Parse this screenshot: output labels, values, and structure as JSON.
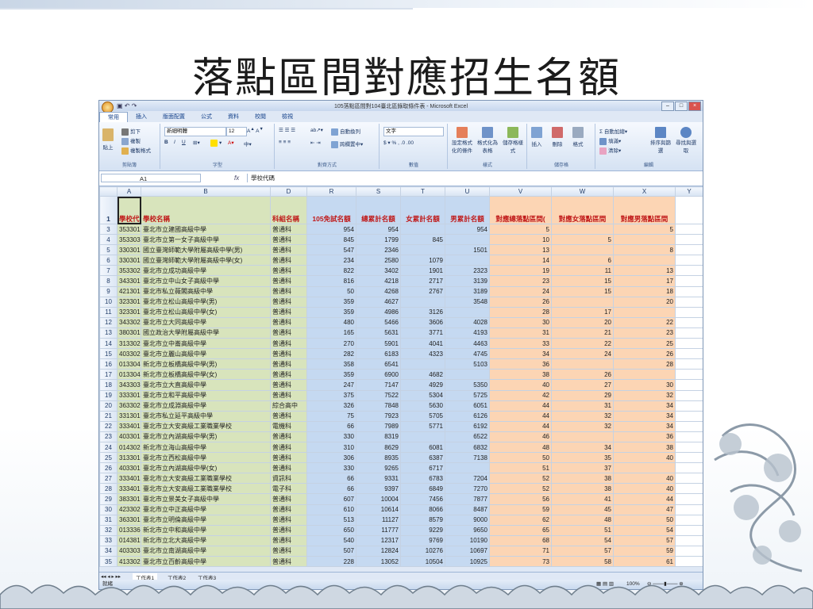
{
  "slide": {
    "title": "落點區間對應招生名額"
  },
  "excel": {
    "window_title": "105落點區間對104臺北區錄取條件表 - Microsoft Excel",
    "tabs": [
      "常用",
      "插入",
      "版面配置",
      "公式",
      "資料",
      "校閱",
      "檢視"
    ],
    "ribbon": {
      "clipboard": {
        "label": "剪貼簿",
        "paste": "貼上",
        "cut": "剪下",
        "copy": "複製",
        "format_painter": "複製格式"
      },
      "font": {
        "label": "字型",
        "name": "新細明體",
        "size": "12"
      },
      "alignment": {
        "label": "對齊方式",
        "wrap": "自動換列",
        "merge": "跨欄置中"
      },
      "number": {
        "label": "數值",
        "format": "文字"
      },
      "styles": {
        "label": "樣式",
        "conditional": "設定格式化的條件",
        "table": "格式化為表格",
        "cell": "儲存格樣式"
      },
      "cells": {
        "label": "儲存格",
        "insert": "插入",
        "delete": "刪除",
        "format": "格式"
      },
      "editing": {
        "label": "編輯",
        "autosum": "自動加總",
        "fill": "填滿",
        "clear": "清除",
        "sort": "排序與篩選",
        "find": "尋找與選取"
      }
    },
    "name_box": "A1",
    "formula": "學校代碼",
    "columns": [
      "A",
      "B",
      "D",
      "R",
      "S",
      "T",
      "U",
      "V",
      "W",
      "X",
      "Y"
    ],
    "header_row": {
      "num": "1",
      "A": "學校代",
      "B": "學校名稱",
      "D": "科組名稱",
      "R": "105免試名額",
      "S": "總累計名額",
      "T": "女累計名額",
      "U": "男累計名額",
      "V": "對應總落點區間(",
      "W": "對應女落點區間",
      "X": "對應男落點區間"
    },
    "rows": [
      [
        "3",
        "353301",
        "臺北市立建國高級中學",
        "普通科",
        "954",
        "954",
        "",
        "954",
        "5",
        "",
        "5"
      ],
      [
        "4",
        "353303",
        "臺北市立第一女子高級中學",
        "普通科",
        "845",
        "1799",
        "845",
        "",
        "10",
        "5",
        ""
      ],
      [
        "5",
        "330301",
        "國立臺灣師範大學附屬高級中學(男)",
        "普通科",
        "547",
        "2346",
        "",
        "1501",
        "13",
        "",
        "8"
      ],
      [
        "6",
        "330301",
        "國立臺灣師範大學附屬高級中學(女)",
        "普通科",
        "234",
        "2580",
        "1079",
        "",
        "14",
        "6",
        ""
      ],
      [
        "7",
        "353302",
        "臺北市立成功高級中學",
        "普通科",
        "822",
        "3402",
        "1901",
        "2323",
        "19",
        "11",
        "13"
      ],
      [
        "8",
        "343301",
        "臺北市立中山女子高級中學",
        "普通科",
        "816",
        "4218",
        "2717",
        "3139",
        "23",
        "15",
        "17"
      ],
      [
        "9",
        "421301",
        "臺北市私立薇閣高級中學",
        "普通科",
        "50",
        "4268",
        "2767",
        "3189",
        "24",
        "15",
        "18"
      ],
      [
        "10",
        "323301",
        "臺北市立松山高級中學(男)",
        "普通科",
        "359",
        "4627",
        "",
        "3548",
        "26",
        "",
        "20"
      ],
      [
        "11",
        "323301",
        "臺北市立松山高級中學(女)",
        "普通科",
        "359",
        "4986",
        "3126",
        "",
        "28",
        "17",
        ""
      ],
      [
        "12",
        "343302",
        "臺北市立大同高級中學",
        "普通科",
        "480",
        "5466",
        "3606",
        "4028",
        "30",
        "20",
        "22"
      ],
      [
        "13",
        "380301",
        "國立政治大學附屬高級中學",
        "普通科",
        "165",
        "5631",
        "3771",
        "4193",
        "31",
        "21",
        "23"
      ],
      [
        "14",
        "313302",
        "臺北市立中崙高級中學",
        "普通科",
        "270",
        "5901",
        "4041",
        "4463",
        "33",
        "22",
        "25"
      ],
      [
        "15",
        "403302",
        "臺北市立麗山高級中學",
        "普通科",
        "282",
        "6183",
        "4323",
        "4745",
        "34",
        "24",
        "26"
      ],
      [
        "16",
        "013304",
        "新北市立板橋高級中學(男)",
        "普通科",
        "358",
        "6541",
        "",
        "5103",
        "36",
        "",
        "28"
      ],
      [
        "17",
        "013304",
        "新北市立板橋高級中學(女)",
        "普通科",
        "359",
        "6900",
        "4682",
        "",
        "38",
        "26",
        ""
      ],
      [
        "18",
        "343303",
        "臺北市立大直高級中學",
        "普通科",
        "247",
        "7147",
        "4929",
        "5350",
        "40",
        "27",
        "30"
      ],
      [
        "19",
        "333301",
        "臺北市立和平高級中學",
        "普通科",
        "375",
        "7522",
        "5304",
        "5725",
        "42",
        "29",
        "32"
      ],
      [
        "20",
        "363302",
        "臺北市立成淵高級中學",
        "綜合高中",
        "326",
        "7848",
        "5630",
        "6051",
        "44",
        "31",
        "34"
      ],
      [
        "21",
        "331301",
        "臺北市私立延平高級中學",
        "普通科",
        "75",
        "7923",
        "5705",
        "6126",
        "44",
        "32",
        "34"
      ],
      [
        "22",
        "333401",
        "臺北市立大安高級工業職業學校",
        "電機科",
        "66",
        "7989",
        "5771",
        "6192",
        "44",
        "32",
        "34"
      ],
      [
        "23",
        "403301",
        "臺北市立內湖高級中學(男)",
        "普通科",
        "330",
        "8319",
        "",
        "6522",
        "46",
        "",
        "36"
      ],
      [
        "24",
        "014302",
        "新北市立海山高級中學",
        "普通科",
        "310",
        "8629",
        "6081",
        "6832",
        "48",
        "34",
        "38"
      ],
      [
        "25",
        "313301",
        "臺北市立西松高級中學",
        "普通科",
        "306",
        "8935",
        "6387",
        "7138",
        "50",
        "35",
        "40"
      ],
      [
        "26",
        "403301",
        "臺北市立內湖高級中學(女)",
        "普通科",
        "330",
        "9265",
        "6717",
        "",
        "51",
        "37",
        ""
      ],
      [
        "27",
        "333401",
        "臺北市立大安高級工業職業學校",
        "資訊科",
        "66",
        "9331",
        "6783",
        "7204",
        "52",
        "38",
        "40"
      ],
      [
        "28",
        "333401",
        "臺北市立大安高級工業職業學校",
        "電子科",
        "66",
        "9397",
        "6849",
        "7270",
        "52",
        "38",
        "40"
      ],
      [
        "29",
        "383301",
        "臺北市立景美女子高級中學",
        "普通科",
        "607",
        "10004",
        "7456",
        "7877",
        "56",
        "41",
        "44"
      ],
      [
        "30",
        "423302",
        "臺北市立中正高級中學",
        "普通科",
        "610",
        "10614",
        "8066",
        "8487",
        "59",
        "45",
        "47"
      ],
      [
        "31",
        "363301",
        "臺北市立明倫高級中學",
        "普通科",
        "513",
        "11127",
        "8579",
        "9000",
        "62",
        "48",
        "50"
      ],
      [
        "32",
        "013336",
        "新北市立中和高級中學",
        "普通科",
        "650",
        "11777",
        "9229",
        "9650",
        "65",
        "51",
        "54"
      ],
      [
        "33",
        "014381",
        "新北市立北大高級中學",
        "普通科",
        "540",
        "12317",
        "9769",
        "10190",
        "68",
        "54",
        "57"
      ],
      [
        "34",
        "403303",
        "臺北市立南湖高級中學",
        "普通科",
        "507",
        "12824",
        "10276",
        "10697",
        "71",
        "57",
        "59"
      ],
      [
        "35",
        "413302",
        "臺北市立百齡高級中學",
        "普通科",
        "228",
        "13052",
        "10504",
        "10925",
        "73",
        "58",
        "61"
      ]
    ],
    "sheet_tabs": [
      "工作表1",
      "工作表2",
      "工作表3"
    ],
    "status_left": "就緒",
    "zoom": "100%"
  }
}
